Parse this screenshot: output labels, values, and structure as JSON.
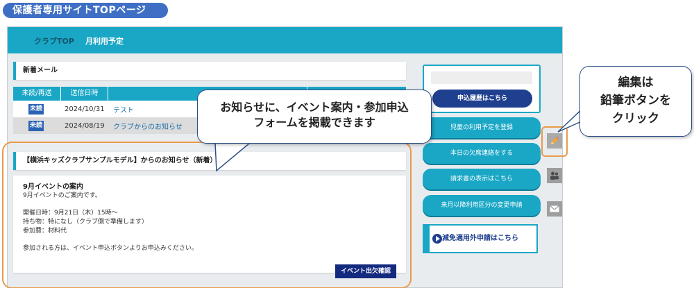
{
  "page_title": "保護者専用サイトTOPページ",
  "nav": {
    "club_top": "クラブTOP",
    "monthly_plan": "月利用予定"
  },
  "mail": {
    "section_title": "新着メール",
    "columns": [
      "未読/再送",
      "送信日時",
      "",
      ""
    ],
    "rows": [
      {
        "status": "未読",
        "date": "2024/10/31",
        "subject": "テスト"
      },
      {
        "status": "未読",
        "date": "2024/08/19",
        "subject": "クラブからのお知らせ"
      }
    ]
  },
  "notice": {
    "header": "【横浜キッズクラブサンプルモデル】からのお知らせ（新着）",
    "title": "9月イベントの案内",
    "intro": "9月イベントのご案内です。",
    "details": [
      "開催日時：9月21日（木）15時～",
      "持ち物：特になし（クラブ側で準備します）",
      "参加費：材料代"
    ],
    "closing": "参加される方は、イベント申込ボタンよりお申込みください。",
    "event_button": "イベント出欠確認"
  },
  "side": {
    "history_button": "申込履歴はこちら",
    "buttons": [
      "児童の利用予定を登録",
      "本日の欠席連絡をする",
      "請求書の表示はこちら",
      "来月以降利用区分の変更申請"
    ],
    "reduction_button": "減免適用外申請はこちら"
  },
  "icons": {
    "edit": "pencil-icon",
    "members": "people-icon",
    "mail": "envelope-icon"
  },
  "callouts": {
    "main": [
      "お知らせに、イベント案内・参加申込",
      "フォームを掲載できます"
    ],
    "edit": [
      "編集は",
      "鉛筆ボタンを",
      "クリック"
    ]
  },
  "colors": {
    "accent": "#1aa7c6",
    "navy": "#1f3f8f",
    "highlight": "#e89a4a",
    "title_pill": "#3f6fc4"
  }
}
